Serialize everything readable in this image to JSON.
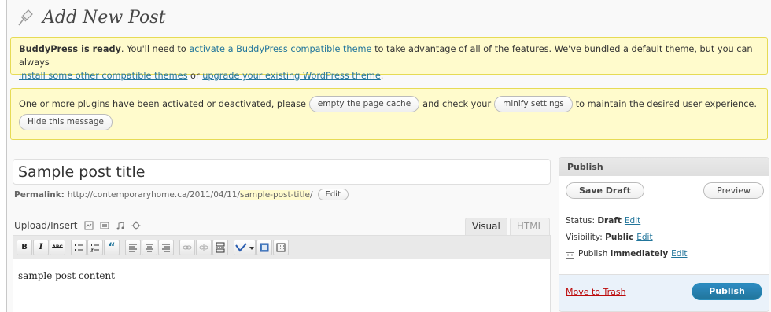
{
  "header": {
    "title": "Add New Post"
  },
  "notices": {
    "buddypress": {
      "lead_bold": "BuddyPress is ready",
      "text1": ". You'll need to ",
      "link1": "activate a BuddyPress compatible theme",
      "text2": " to take advantage of all of the features. We've bundled a default theme, but you can always",
      "link2": "install some other compatible themes",
      "text3": " or ",
      "link3": "upgrade your existing WordPress theme",
      "text4": "."
    },
    "cache": {
      "text1": "One or more plugins have been activated or deactivated, please",
      "button1": "empty the page cache",
      "text2": "and check your",
      "button2": "minify settings",
      "text3": "to maintain the desired user experience.",
      "hide_button": "Hide this message"
    }
  },
  "post": {
    "title_value": "Sample post title",
    "permalink_label": "Permalink:",
    "permalink_base": "http://contemporaryhome.ca/2011/04/11/",
    "permalink_slug": "sample-post-title",
    "permalink_trailing": "/",
    "permalink_edit": "Edit",
    "upload_insert": "Upload/Insert",
    "tabs": [
      "Visual",
      "HTML"
    ],
    "content": "sample post content"
  },
  "toolbar": {
    "bold": "B",
    "italic": "I",
    "strike": "ABC",
    "quote": "“"
  },
  "publish": {
    "heading": "Publish",
    "save_draft": "Save Draft",
    "preview": "Preview",
    "status_label": "Status:",
    "status_value": "Draft",
    "visibility_label": "Visibility:",
    "visibility_value": "Public",
    "schedule_label": "Publish",
    "schedule_value": "immediately",
    "edit": "Edit",
    "trash": "Move to Trash",
    "publish_button": "Publish"
  }
}
